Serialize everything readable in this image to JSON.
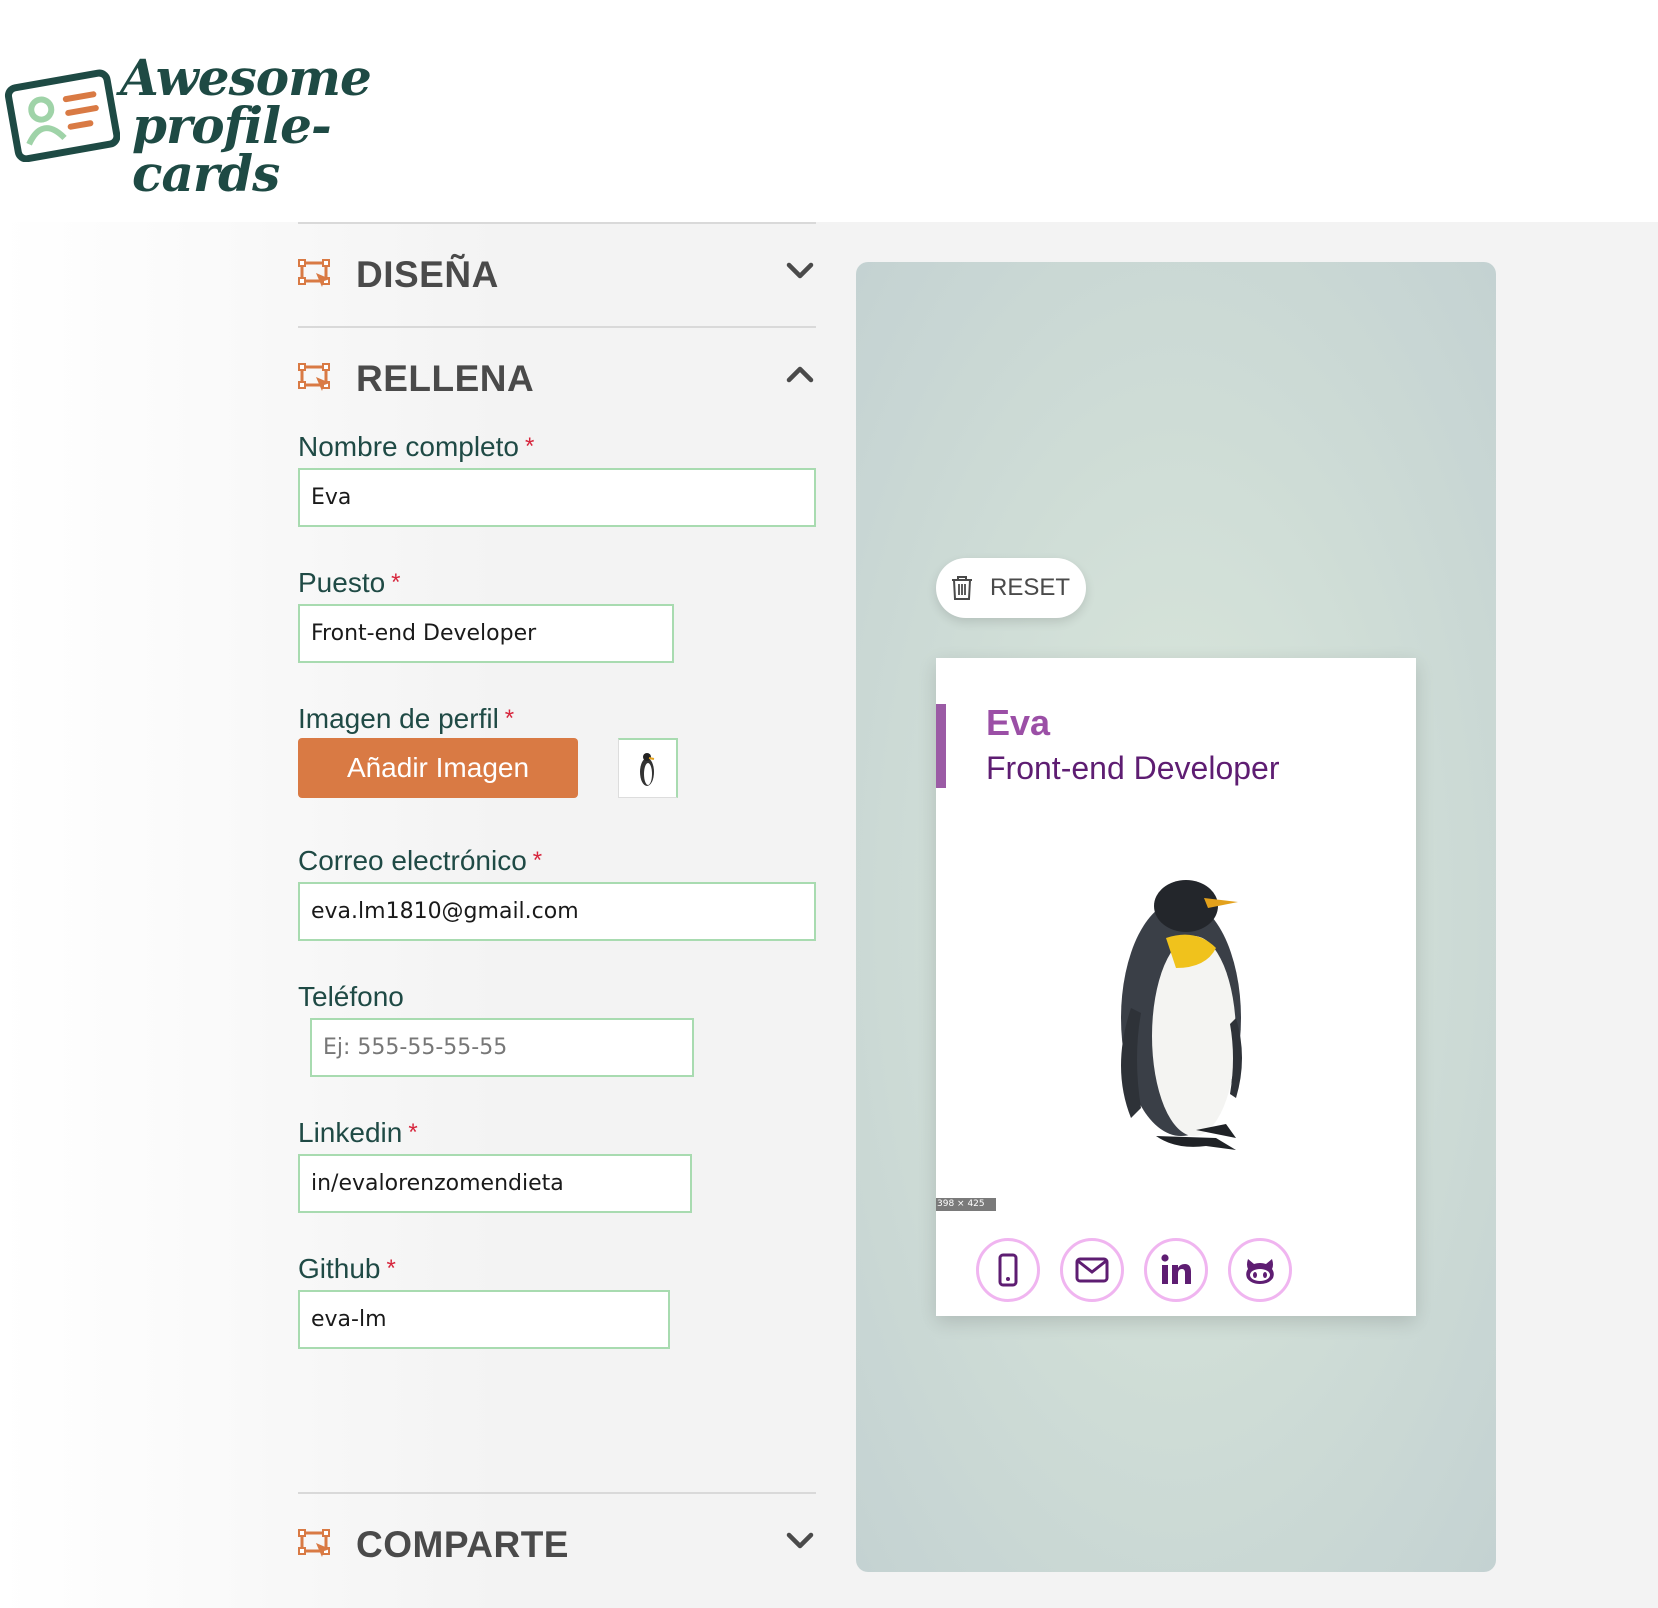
{
  "app": {
    "logo_line1": "Awesome",
    "logo_line2": "profile-cards"
  },
  "sections": {
    "design_title": "DISEÑA",
    "fill_title": "RELLENA",
    "share_title": "COMPARTE"
  },
  "form": {
    "name_label": "Nombre completo",
    "name_value": "Eva",
    "job_label": "Puesto",
    "job_value": "Front-end Developer",
    "image_label": "Imagen de perfil",
    "add_image_label": "Añadir Imagen",
    "email_label": "Correo electrónico",
    "email_value": "eva.lm1810@gmail.com",
    "phone_label": "Teléfono",
    "phone_placeholder": "Ej: 555-55-55-55",
    "linkedin_label": "Linkedin",
    "linkedin_value": "in/evalorenzomendieta",
    "github_label": "Github",
    "github_value": "eva-lm",
    "required_mark": "*"
  },
  "preview": {
    "reset_label": "RESET",
    "card_name": "Eva",
    "card_job": "Front-end Developer",
    "image_size_tag": "398 × 425",
    "social_icons": [
      "phone-icon",
      "email-icon",
      "linkedin-icon",
      "github-icon"
    ]
  },
  "colors": {
    "accent_orange": "#d97a44",
    "field_border": "#a8dbb0",
    "heading_green": "#1f4a45",
    "card_name_purple": "#9b4fa6",
    "card_job_purple": "#5e1d72",
    "social_border": "#f0b5f0",
    "required_red": "#d7263d"
  }
}
